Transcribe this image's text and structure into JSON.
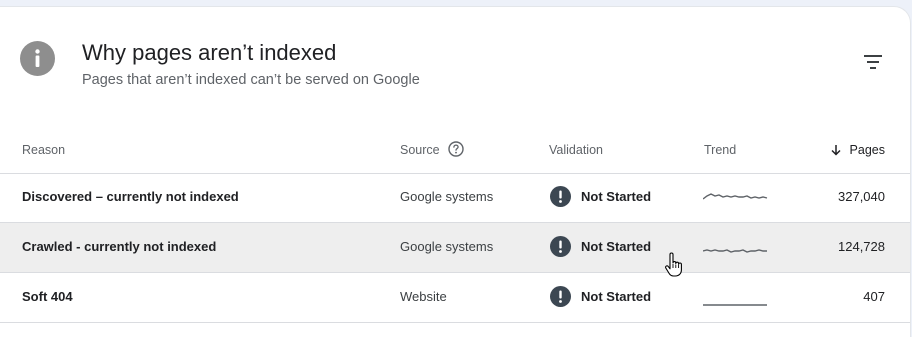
{
  "header": {
    "title": "Why pages aren’t indexed",
    "subtitle": "Pages that aren’t indexed can’t be served on Google",
    "info_icon": "info-icon",
    "filter_icon": "filter-icon"
  },
  "columns": {
    "reason": "Reason",
    "source": "Source",
    "validation": "Validation",
    "trend": "Trend",
    "pages": "Pages",
    "pages_sort_icon": "arrow-down-icon",
    "source_help_icon": "help-icon"
  },
  "rows": [
    {
      "reason": "Discovered – currently not indexed",
      "source": "Google systems",
      "validation": "Not Started",
      "pages": "327,040"
    },
    {
      "reason": "Crawled - currently not indexed",
      "source": "Google systems",
      "validation": "Not Started",
      "pages": "124,728"
    },
    {
      "reason": "Soft 404",
      "source": "Website",
      "validation": "Not Started",
      "pages": "407"
    }
  ],
  "colors": {
    "accent_icon": "#8e8e8e",
    "status_icon": "#3c4752",
    "highlight_row": "#eeeeee",
    "background": "#edf1f9"
  }
}
